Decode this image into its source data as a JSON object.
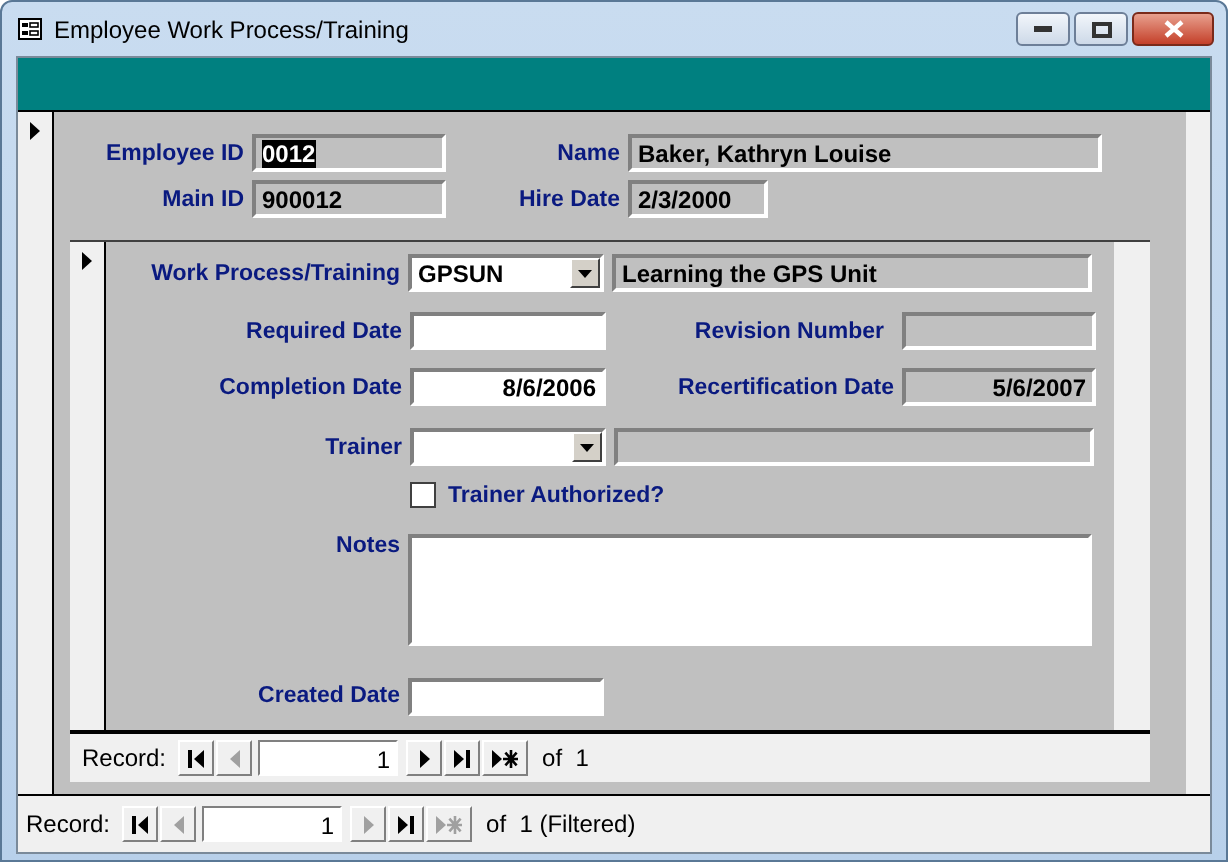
{
  "window": {
    "title": "Employee Work Process/Training"
  },
  "employee": {
    "fields": [
      {
        "label": "Employee ID",
        "value": "0012",
        "locked": true,
        "highlighted": true
      },
      {
        "label": "Name",
        "value": "Baker, Kathryn Louise",
        "locked": true,
        "highlighted": false
      },
      {
        "label": "Main ID",
        "value": "900012",
        "locked": true,
        "highlighted": false
      },
      {
        "label": "Hire Date",
        "value": "2/3/2000",
        "locked": true,
        "highlighted": false
      }
    ]
  },
  "training": {
    "work_process": {
      "label": "Work Process/Training",
      "value": "GPSUN",
      "description": "Learning the GPS Unit"
    },
    "required_date": {
      "label": "Required Date",
      "locked": false
    },
    "revision_number": {
      "label": "Revision Number",
      "locked": true
    },
    "completion_date": {
      "label": "Completion Date",
      "value": "8/6/2006",
      "locked": false
    },
    "recertification_date": {
      "label": "Recertification Date",
      "value": "5/6/2007",
      "locked": true
    },
    "trainer": {
      "label": "Trainer"
    },
    "trainer_authorized": {
      "label": "Trainer Authorized?",
      "checked": false
    },
    "notes": {
      "label": "Notes"
    },
    "created_date": {
      "label": "Created Date",
      "locked": false
    }
  },
  "subform_navigation": {
    "label": "Record:",
    "current": "1",
    "total": "of  1",
    "buttons": [
      {
        "kind": "first",
        "disabled": false
      },
      {
        "kind": "previous",
        "disabled": true
      },
      {
        "kind": "next",
        "disabled": false
      },
      {
        "kind": "last",
        "disabled": false
      },
      {
        "kind": "new",
        "disabled": false
      }
    ]
  },
  "form_navigation": {
    "label": "Record:",
    "current": "1",
    "total": "of  1 (Filtered)",
    "buttons": [
      {
        "kind": "first",
        "disabled": false
      },
      {
        "kind": "previous",
        "disabled": true
      },
      {
        "kind": "next",
        "disabled": true
      },
      {
        "kind": "last",
        "disabled": false
      },
      {
        "kind": "new",
        "disabled": true
      }
    ]
  }
}
